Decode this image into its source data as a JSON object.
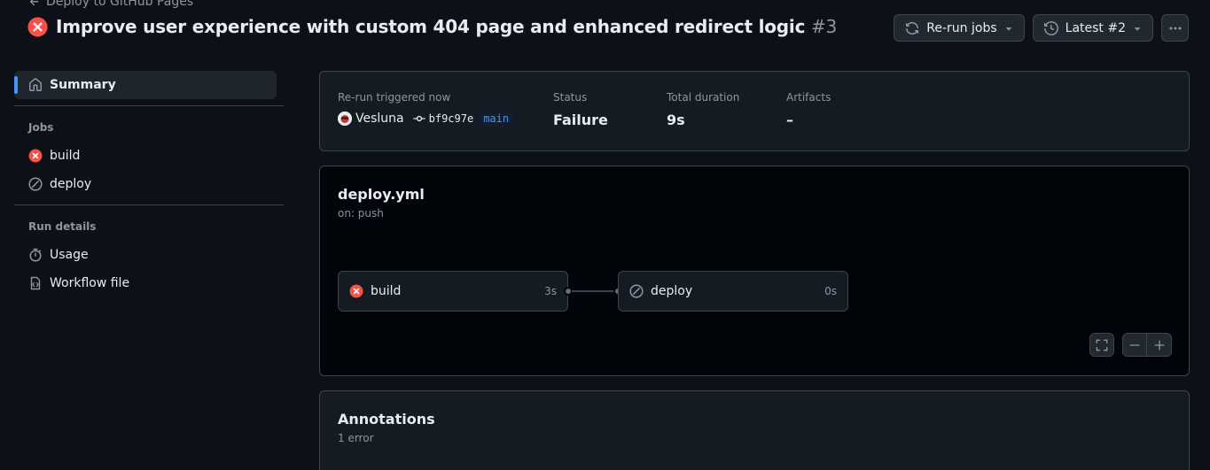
{
  "header": {
    "back_link": "Deploy to GitHub Pages",
    "title": "Improve user experience with custom 404 page and enhanced redirect logic",
    "run_number": "#3",
    "status_icon": "x-circle-fill-icon",
    "actions": {
      "rerun_label": "Re-run jobs",
      "latest_label": "Latest #2"
    }
  },
  "sidebar": {
    "summary_label": "Summary",
    "jobs_heading": "Jobs",
    "jobs": [
      {
        "label": "build",
        "status": "failure"
      },
      {
        "label": "deploy",
        "status": "skipped"
      }
    ],
    "run_details_heading": "Run details",
    "details": [
      {
        "label": "Usage"
      },
      {
        "label": "Workflow file"
      }
    ]
  },
  "summary": {
    "trigger_label": "Re-run triggered now",
    "actor": "Vesluna",
    "commit": "bf9c97e",
    "branch": "main",
    "status_label": "Status",
    "status_value": "Failure",
    "duration_label": "Total duration",
    "duration_value": "9s",
    "artifacts_label": "Artifacts",
    "artifacts_value": "–"
  },
  "workflow": {
    "file": "deploy.yml",
    "trigger": "on: push",
    "jobs": [
      {
        "name": "build",
        "duration": "3s",
        "status": "failure"
      },
      {
        "name": "deploy",
        "duration": "0s",
        "status": "skipped"
      }
    ]
  },
  "annotations": {
    "title": "Annotations",
    "count": "1 error"
  },
  "colors": {
    "background": "#0d1117",
    "card": "#151b23",
    "border": "#3d444d",
    "failure": "#f85149",
    "accent": "#4493f8",
    "muted": "#8d96a0"
  }
}
